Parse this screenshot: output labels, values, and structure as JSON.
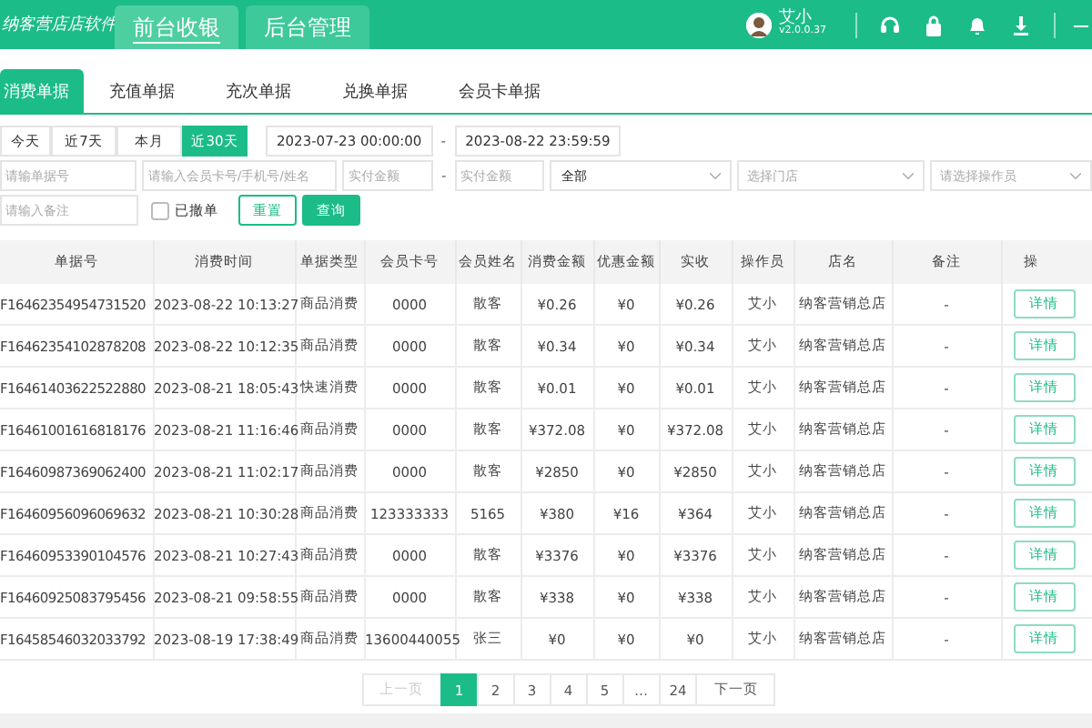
{
  "header": {
    "logo": "纳客营店店软件",
    "tabs": [
      {
        "label": "前台收银",
        "selected": true
      },
      {
        "label": "后台管理",
        "selected": false
      }
    ],
    "user": {
      "name": "艾小",
      "version": "v2.0.0.37"
    }
  },
  "sub_tabs": [
    {
      "label": "消费单据",
      "selected": true
    },
    {
      "label": "充值单据",
      "selected": false
    },
    {
      "label": "充次单据",
      "selected": false
    },
    {
      "label": "兑换单据",
      "selected": false
    },
    {
      "label": "会员卡单据",
      "selected": false
    }
  ],
  "filters": {
    "ranges": [
      {
        "label": "今天",
        "selected": false
      },
      {
        "label": "近7天",
        "selected": false
      },
      {
        "label": "本月",
        "selected": false
      },
      {
        "label": "近30天",
        "selected": true
      }
    ],
    "date_start": "2023-07-23 00:00:00",
    "date_separator": "-",
    "date_end": "2023-08-22 23:59:59",
    "fields": [
      {
        "kind": "input",
        "placeholder": "请输单据号"
      },
      {
        "kind": "input",
        "placeholder": "请输入会员卡号/手机号/姓名"
      },
      {
        "kind": "input",
        "placeholder": "实付金额"
      },
      {
        "kind": "separator",
        "text": "-"
      },
      {
        "kind": "input",
        "placeholder": "实付金额"
      },
      {
        "kind": "select",
        "value": "全部"
      },
      {
        "kind": "select",
        "placeholder": "选择门店"
      },
      {
        "kind": "select",
        "placeholder": "请选择操作员"
      }
    ],
    "remark": {
      "placeholder": "请输入备注"
    },
    "revoked": {
      "label": "已撤单",
      "checked": false
    },
    "buttons": [
      {
        "label": "重置",
        "kind": "outline"
      },
      {
        "label": "查询",
        "kind": "primary"
      }
    ]
  },
  "table": {
    "columns": [
      "单据号",
      "消费时间",
      "单据类型",
      "会员卡号",
      "会员姓名",
      "消费金额",
      "优惠金额",
      "实收",
      "操作员",
      "店名",
      "备注",
      "操"
    ],
    "rows": [
      {
        "cells": [
          "F16462354954731520",
          "2023-08-22 10:13:27",
          "商品消费",
          "0000",
          "散客",
          "¥0.26",
          "¥0",
          "¥0.26",
          "艾小",
          "纳客营销总店",
          "-"
        ],
        "action": "详情"
      },
      {
        "cells": [
          "F16462354102878208",
          "2023-08-22 10:12:35",
          "商品消费",
          "0000",
          "散客",
          "¥0.34",
          "¥0",
          "¥0.34",
          "艾小",
          "纳客营销总店",
          "-"
        ],
        "action": "详情"
      },
      {
        "cells": [
          "F16461403622522880",
          "2023-08-21 18:05:43",
          "快速消费",
          "0000",
          "散客",
          "¥0.01",
          "¥0",
          "¥0.01",
          "艾小",
          "纳客营销总店",
          "-"
        ],
        "action": "详情"
      },
      {
        "cells": [
          "F16461001616818176",
          "2023-08-21 11:16:46",
          "商品消费",
          "0000",
          "散客",
          "¥372.08",
          "¥0",
          "¥372.08",
          "艾小",
          "纳客营销总店",
          "-"
        ],
        "action": "详情"
      },
      {
        "cells": [
          "F16460987369062400",
          "2023-08-21 11:02:17",
          "商品消费",
          "0000",
          "散客",
          "¥2850",
          "¥0",
          "¥2850",
          "艾小",
          "纳客营销总店",
          "-"
        ],
        "action": "详情"
      },
      {
        "cells": [
          "F16460956096069632",
          "2023-08-21 10:30:28",
          "商品消费",
          "123333333",
          "5165",
          "¥380",
          "¥16",
          "¥364",
          "艾小",
          "纳客营销总店",
          "-"
        ],
        "action": "详情"
      },
      {
        "cells": [
          "F16460953390104576",
          "2023-08-21 10:27:43",
          "商品消费",
          "0000",
          "散客",
          "¥3376",
          "¥0",
          "¥3376",
          "艾小",
          "纳客营销总店",
          "-"
        ],
        "action": "详情"
      },
      {
        "cells": [
          "F16460925083795456",
          "2023-08-21 09:58:55",
          "商品消费",
          "0000",
          "散客",
          "¥338",
          "¥0",
          "¥338",
          "艾小",
          "纳客营销总店",
          "-"
        ],
        "action": "详情"
      },
      {
        "cells": [
          "F16458546032033792",
          "2023-08-19 17:38:49",
          "商品消费",
          "13600440055",
          "张三",
          "¥0",
          "¥0",
          "¥0",
          "艾小",
          "纳客营销总店",
          "-"
        ],
        "action": "详情"
      }
    ]
  },
  "pagination": {
    "prev": {
      "label": "上一页",
      "disabled": true
    },
    "pages": [
      {
        "label": "1",
        "selected": true
      },
      {
        "label": "2",
        "selected": false
      },
      {
        "label": "3",
        "selected": false
      },
      {
        "label": "4",
        "selected": false
      },
      {
        "label": "5",
        "selected": false
      },
      {
        "label": "…",
        "selected": false
      },
      {
        "label": "24",
        "selected": false
      }
    ],
    "next": {
      "label": "下一页",
      "disabled": false
    }
  }
}
